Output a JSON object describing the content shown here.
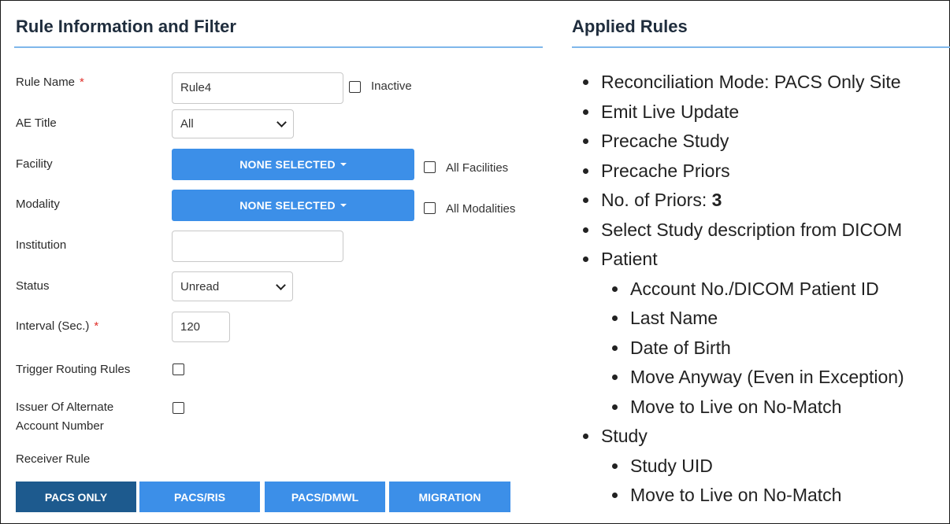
{
  "left_panel": {
    "title": "Rule Information and Filter",
    "fields": {
      "rule_name": {
        "label": "Rule Name",
        "required_mark": "*",
        "value": "Rule4",
        "inactive_label": "Inactive"
      },
      "ae_title": {
        "label": "AE Title",
        "value": "All"
      },
      "facility": {
        "label": "Facility",
        "button": "NONE SELECTED",
        "all_label": "All Facilities"
      },
      "modality": {
        "label": "Modality",
        "button": "NONE SELECTED",
        "all_label": "All Modalities"
      },
      "institution": {
        "label": "Institution",
        "value": ""
      },
      "status": {
        "label": "Status",
        "value": "Unread"
      },
      "interval": {
        "label": "Interval (Sec.)",
        "required_mark": "*",
        "value": "120"
      },
      "trigger_routing": {
        "label": "Trigger Routing Rules"
      },
      "issuer": {
        "label_line1": "Issuer Of Alternate",
        "label_line2": "Account Number"
      },
      "receiver_rule": {
        "label": "Receiver Rule"
      }
    },
    "mode_buttons": [
      "PACS ONLY",
      "PACS/RIS",
      "PACS/DMWL",
      "MIGRATION"
    ],
    "active_mode": "PACS ONLY"
  },
  "right_panel": {
    "title": "Applied Rules",
    "items": {
      "reconciliation": "Reconciliation Mode: PACS Only Site",
      "emit_live": "Emit Live Update",
      "precache_study": "Precache Study",
      "precache_priors": "Precache Priors",
      "priors_label": "No. of Priors: ",
      "priors_value": "3",
      "select_desc": "Select Study description from DICOM",
      "patient": "Patient",
      "account_no": "Account No./DICOM Patient ID",
      "last_name": "Last Name",
      "dob": "Date of Birth",
      "move_anyway": "Move Anyway (Even in Exception)",
      "patient_move_live": "Move to Live on No-Match",
      "study": "Study",
      "study_uid": "Study UID",
      "study_move_live": "Move to Live on No-Match"
    }
  }
}
